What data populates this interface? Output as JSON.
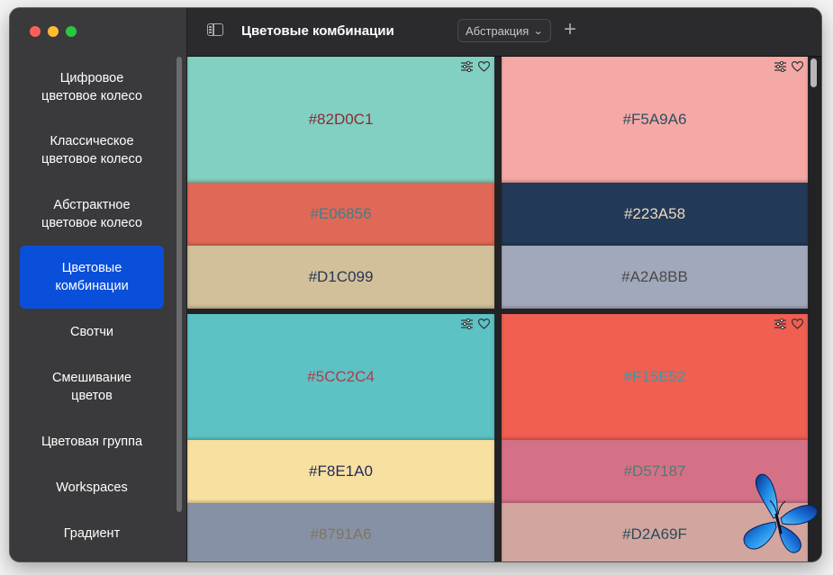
{
  "window": {
    "traffic_lights": [
      "close",
      "minimize",
      "zoom"
    ]
  },
  "toolbar": {
    "sidebar_toggle_icon": "sidebar-toggle-icon",
    "title": "Цветовые комбинации",
    "dropdown_value": "Абстракция",
    "dropdown_chevron": "⌄",
    "add_label": "+"
  },
  "sidebar": {
    "items": [
      {
        "label": "Цифровое\nцветовое колесо",
        "active": false
      },
      {
        "label": "Классическое\nцветовое колесо",
        "active": false
      },
      {
        "label": "Абстрактное\nцветовое колесо",
        "active": false
      },
      {
        "label": "Цветовые\nкомбинации",
        "active": true
      },
      {
        "label": "Свотчи",
        "active": false
      },
      {
        "label": "Смешивание\nцветов",
        "active": false
      },
      {
        "label": "Цветовая группа",
        "active": false
      },
      {
        "label": "Workspaces",
        "active": false
      },
      {
        "label": "Градиент",
        "active": false
      }
    ]
  },
  "combinations": [
    {
      "colors": [
        {
          "hex": "#82D0C1",
          "label": "#82D0C1",
          "text_color": "#8a2b3a"
        },
        {
          "hex": "#E06856",
          "label": "#E06856",
          "text_color": "#3f7f8d"
        },
        {
          "hex": "#D1C099",
          "label": "#D1C099",
          "text_color": "#2a3556"
        }
      ]
    },
    {
      "colors": [
        {
          "hex": "#F5A9A6",
          "label": "#F5A9A6",
          "text_color": "#2c4f63"
        },
        {
          "hex": "#223A58",
          "label": "#223A58",
          "text_color": "#f0d6bf"
        },
        {
          "hex": "#A2A8BB",
          "label": "#A2A8BB",
          "text_color": "#4a4a4a"
        }
      ]
    },
    {
      "colors": [
        {
          "hex": "#5CC2C4",
          "label": "#5CC2C4",
          "text_color": "#b23a48"
        },
        {
          "hex": "#F8E1A0",
          "label": "#F8E1A0",
          "text_color": "#1f2a5a"
        },
        {
          "hex": "#8791A6",
          "label": "#8791A6",
          "text_color": "#7d7560"
        }
      ]
    },
    {
      "colors": [
        {
          "hex": "#F15E52",
          "label": "#F15E52",
          "text_color": "#3d9aa0"
        },
        {
          "hex": "#D57187",
          "label": "#D57187",
          "text_color": "#4f7a78"
        },
        {
          "hex": "#D2A69F",
          "label": "#D2A69F",
          "text_color": "#2e4a5a"
        }
      ]
    }
  ],
  "card_icons": [
    "sliders-icon",
    "heart-icon"
  ],
  "decoration": {
    "butterfly": "butterfly-icon"
  }
}
